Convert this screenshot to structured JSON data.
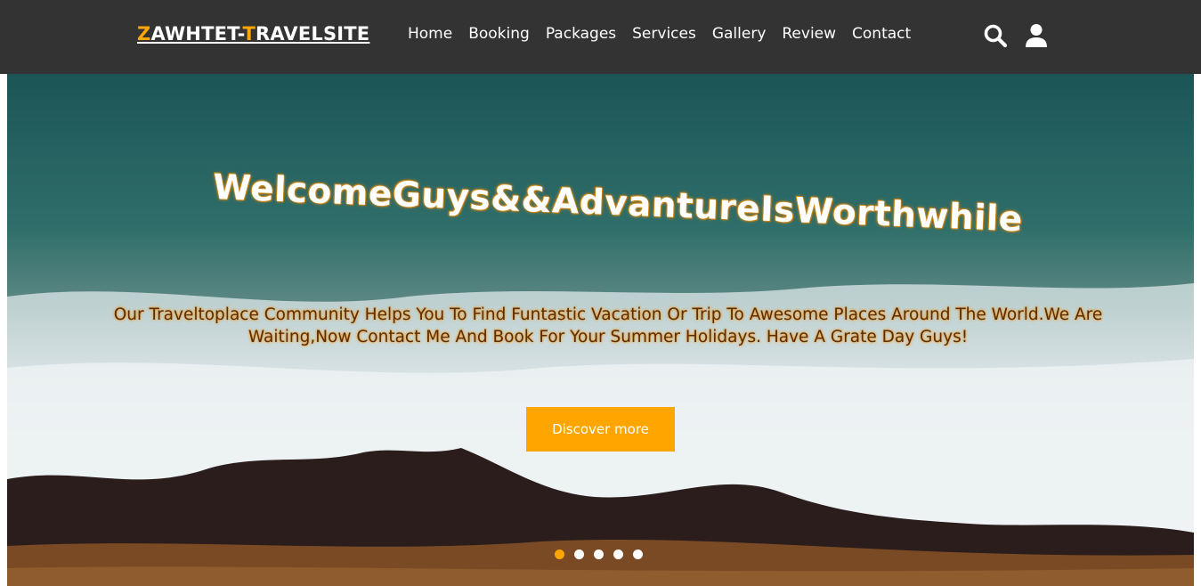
{
  "brand": {
    "part1_accent": "Z",
    "part1_rest": "AWHTET-",
    "part2_accent": "T",
    "part2_rest": "RAVELSITE",
    "accent_color": "#ffa500"
  },
  "nav": {
    "items": [
      {
        "label": "Home"
      },
      {
        "label": "Booking"
      },
      {
        "label": "Packages"
      },
      {
        "label": "Services"
      },
      {
        "label": "Gallery"
      },
      {
        "label": "Review"
      },
      {
        "label": "Contact"
      }
    ],
    "icons": [
      "search-icon",
      "user-icon"
    ]
  },
  "hero": {
    "title": "WelcomeGuys&&AdvantureIsWorthwhile",
    "description": "Our Traveltoplace Community Helps You To Find Funtastic Vacation Or Trip To Awesome Places Around The World.We Are Waiting,Now Contact Me And Book For Your Summer Holidays. Have A Grate Day Guys!",
    "button_label": "Discover more",
    "slides_count": 5,
    "active_slide": 1
  },
  "colors": {
    "navbar": "#333333",
    "accent": "#ffa500",
    "nav_text": "#ffffff"
  }
}
